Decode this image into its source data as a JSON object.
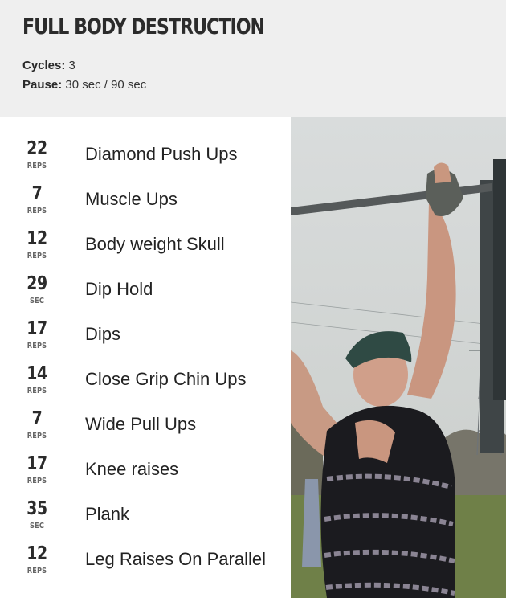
{
  "workout": {
    "title": "FULL BODY DESTRUCTION",
    "cycles_label": "Cycles:",
    "cycles_value": "3",
    "pause_label": "Pause:",
    "pause_value": "30 sec / 90 sec"
  },
  "exercises": [
    {
      "count": "22",
      "unit": "REPS",
      "name": "Diamond Push Ups"
    },
    {
      "count": "7",
      "unit": "REPS",
      "name": "Muscle Ups"
    },
    {
      "count": "12",
      "unit": "REPS",
      "name": "Body weight Skull"
    },
    {
      "count": "29",
      "unit": "SEC",
      "name": "Dip Hold"
    },
    {
      "count": "17",
      "unit": "REPS",
      "name": "Dips"
    },
    {
      "count": "14",
      "unit": "REPS",
      "name": "Close Grip Chin Ups"
    },
    {
      "count": "7",
      "unit": "REPS",
      "name": "Wide Pull Ups"
    },
    {
      "count": "17",
      "unit": "REPS",
      "name": "Knee raises"
    },
    {
      "count": "35",
      "unit": "SEC",
      "name": "Plank"
    },
    {
      "count": "12",
      "unit": "REPS",
      "name": "Leg Raises On Parallel"
    }
  ],
  "colors": {
    "header_bg": "#efefef",
    "text": "#222222",
    "unit_text": "#666666"
  }
}
